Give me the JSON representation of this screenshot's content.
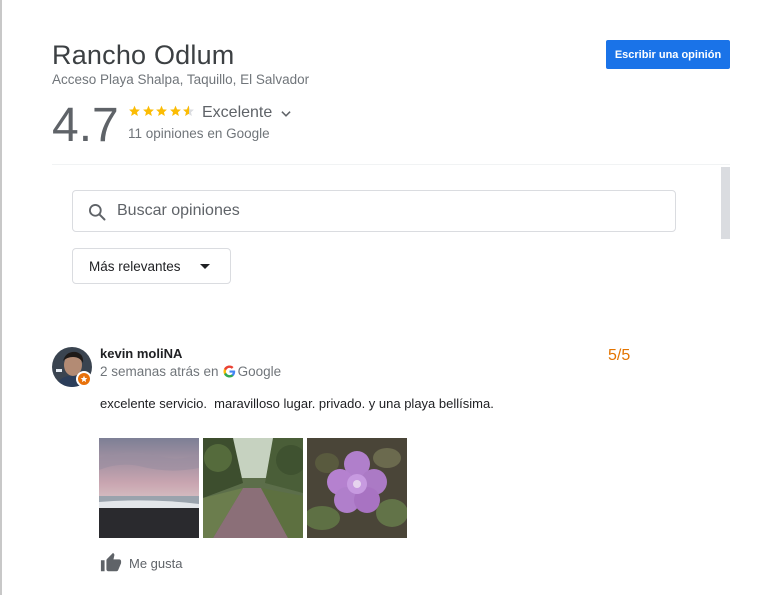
{
  "place": {
    "name": "Rancho Odlum",
    "address": "Acceso Playa Shalpa, Taquillo, El Salvador",
    "write_review_label": "Escribir una opinión"
  },
  "rating": {
    "value": "4.7",
    "stars_value": 4.7,
    "word": "Excelente",
    "count_text": "11 opiniones en Google"
  },
  "search": {
    "placeholder": "Buscar opiniones",
    "value": ""
  },
  "sort": {
    "selected": "Más relevantes"
  },
  "reviews": [
    {
      "name": "kevin moliNA",
      "time": "2 semanas atrás en",
      "source": "Google",
      "score": "5/5",
      "text": "excelente servicio.  maravilloso lugar. privado. y una playa bellísima.",
      "photos": [
        "beach-sunset-photo",
        "dirt-path-photo",
        "purple-flower-photo"
      ],
      "like_label": "Me gusta"
    }
  ],
  "colors": {
    "accent": "#1a73e8",
    "star": "#fbbc04",
    "score": "#e37400",
    "badge": "#e8710a"
  }
}
